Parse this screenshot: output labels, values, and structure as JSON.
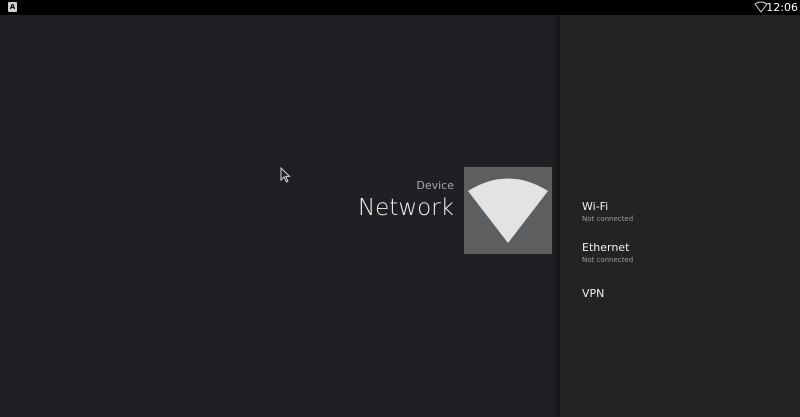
{
  "status_bar": {
    "app_icon_letter": "A",
    "clock": "12:06",
    "wifi_icon": "wifi-outline-icon",
    "notification_icon": "app-notification-icon"
  },
  "header": {
    "breadcrumb": "Device",
    "title": "Network",
    "hero_icon": "wifi-icon"
  },
  "menu": {
    "items": [
      {
        "label": "Wi-Fi",
        "status": "Not connected"
      },
      {
        "label": "Ethernet",
        "status": "Not connected"
      },
      {
        "label": "VPN",
        "status": ""
      }
    ]
  },
  "colors": {
    "background": "#1f2023",
    "right_pane": "#232325",
    "hero_tile": "#5d5e60",
    "hero_glyph": "#e3e3e3",
    "status_bar": "#000000"
  }
}
